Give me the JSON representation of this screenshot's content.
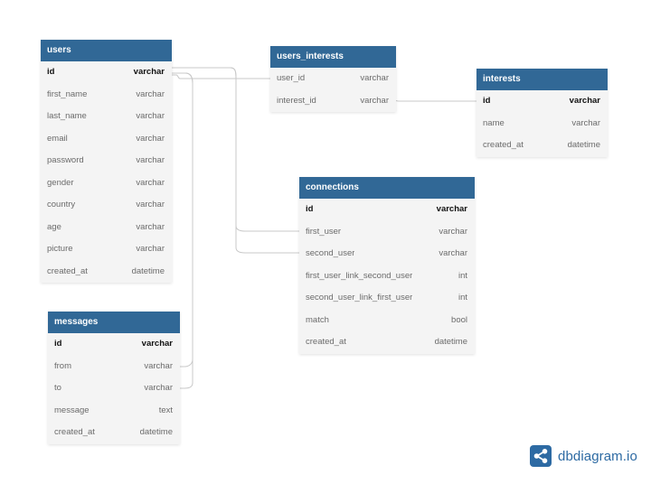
{
  "tables": {
    "users": {
      "name": "users",
      "fields": [
        {
          "name": "id",
          "type": "varchar",
          "pk": true
        },
        {
          "name": "first_name",
          "type": "varchar"
        },
        {
          "name": "last_name",
          "type": "varchar"
        },
        {
          "name": "email",
          "type": "varchar"
        },
        {
          "name": "password",
          "type": "varchar"
        },
        {
          "name": "gender",
          "type": "varchar"
        },
        {
          "name": "country",
          "type": "varchar"
        },
        {
          "name": "age",
          "type": "varchar"
        },
        {
          "name": "picture",
          "type": "varchar"
        },
        {
          "name": "created_at",
          "type": "datetime"
        }
      ]
    },
    "users_interests": {
      "name": "users_interests",
      "fields": [
        {
          "name": "user_id",
          "type": "varchar"
        },
        {
          "name": "interest_id",
          "type": "varchar"
        }
      ]
    },
    "interests": {
      "name": "interests",
      "fields": [
        {
          "name": "id",
          "type": "varchar",
          "pk": true
        },
        {
          "name": "name",
          "type": "varchar"
        },
        {
          "name": "created_at",
          "type": "datetime"
        }
      ]
    },
    "connections": {
      "name": "connections",
      "fields": [
        {
          "name": "id",
          "type": "varchar",
          "pk": true
        },
        {
          "name": "first_user",
          "type": "varchar"
        },
        {
          "name": "second_user",
          "type": "varchar"
        },
        {
          "name": "first_user_link_second_user",
          "type": "int"
        },
        {
          "name": "second_user_link_first_user",
          "type": "int"
        },
        {
          "name": "match",
          "type": "bool"
        },
        {
          "name": "created_at",
          "type": "datetime"
        }
      ]
    },
    "messages": {
      "name": "messages",
      "fields": [
        {
          "name": "id",
          "type": "varchar",
          "pk": true
        },
        {
          "name": "from",
          "type": "varchar"
        },
        {
          "name": "to",
          "type": "varchar"
        },
        {
          "name": "message",
          "type": "text"
        },
        {
          "name": "created_at",
          "type": "datetime"
        }
      ]
    }
  },
  "relationships": [
    {
      "from": "users.id",
      "to": "users_interests.user_id"
    },
    {
      "from": "interests.id",
      "to": "users_interests.interest_id"
    },
    {
      "from": "users.id",
      "to": "connections.first_user"
    },
    {
      "from": "users.id",
      "to": "connections.second_user"
    },
    {
      "from": "users.id",
      "to": "messages.from"
    },
    {
      "from": "users.id",
      "to": "messages.to"
    }
  ],
  "brand": {
    "text": "dbdiagram.io",
    "icon": "share-nodes-icon"
  },
  "colors": {
    "header": "#316896",
    "connector": "#c8c8c8",
    "brand": "#2d6aa3"
  }
}
